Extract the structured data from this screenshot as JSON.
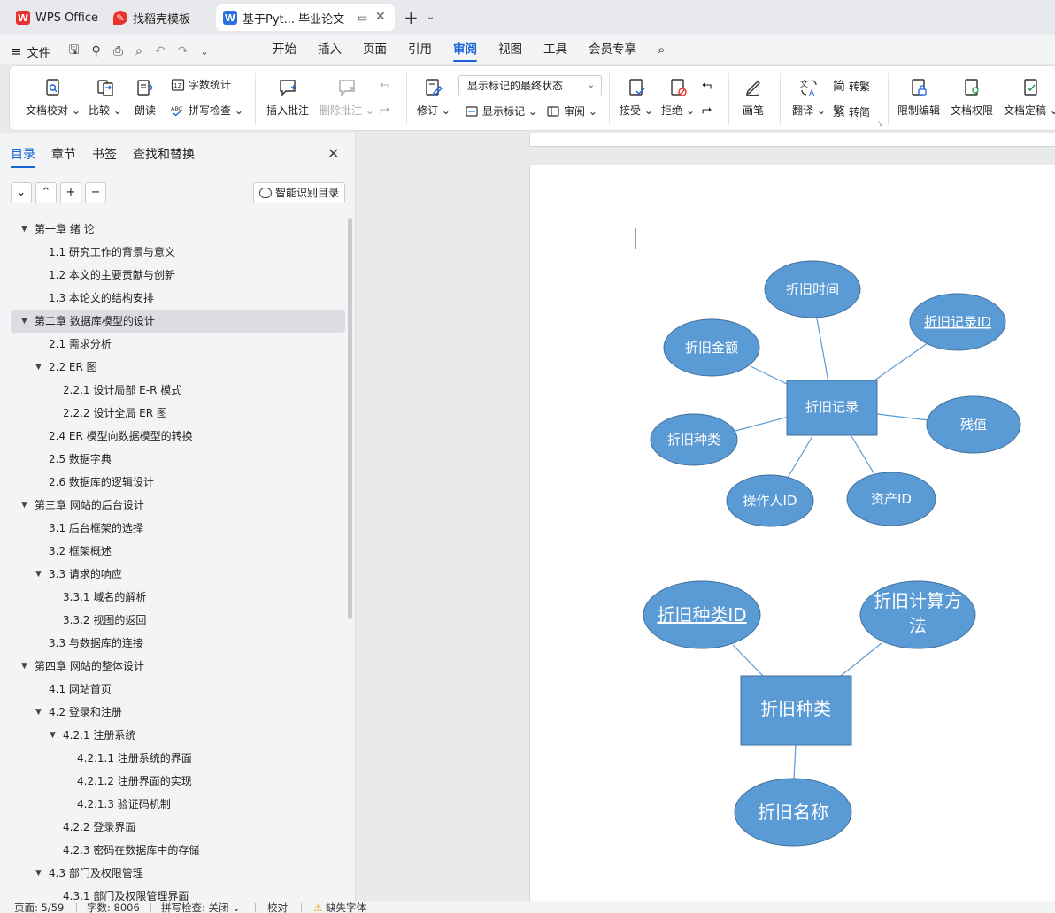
{
  "tabs": [
    {
      "label": "WPS Office",
      "icon": "wps-logo-icon"
    },
    {
      "label": "找稻壳模板",
      "icon": "docer-icon"
    },
    {
      "label": "基于Pyt... 毕业论文",
      "icon": "word-doc-icon"
    }
  ],
  "menu": {
    "file": "文件",
    "tabs": [
      "开始",
      "插入",
      "页面",
      "引用",
      "审阅",
      "视图",
      "工具",
      "会员专享"
    ],
    "active_tab": "审阅"
  },
  "ribbon": {
    "doc_check": "文档校对",
    "compare": "比较",
    "read_aloud": "朗读",
    "word_count": "字数统计",
    "spell_check": "拼写检查",
    "insert_comment": "插入批注",
    "delete_comment": "删除批注",
    "revise": "修订",
    "markup_state": "显示标记的最终状态",
    "show_markup": "显示标记",
    "review": "审阅",
    "accept": "接受",
    "reject": "拒绝",
    "pen": "画笔",
    "translate": "翻译",
    "to_traditional": "转繁",
    "to_simplified": "转简",
    "restrict_edit": "限制编辑",
    "doc_permission": "文档权限",
    "doc_finalize": "文档定稿"
  },
  "nav": {
    "tabs": [
      "目录",
      "章节",
      "书签",
      "查找和替换"
    ],
    "smart_toc": "智能识别目录",
    "toc": [
      {
        "text": "第一章  绪  论",
        "level": 0,
        "expand": true
      },
      {
        "text": "1.1  研究工作的背景与意义",
        "level": 1
      },
      {
        "text": "1.2  本文的主要贡献与创新",
        "level": 1
      },
      {
        "text": "1.3  本论文的结构安排",
        "level": 1
      },
      {
        "text": "第二章  数据库模型的设计",
        "level": 0,
        "expand": true,
        "selected": true
      },
      {
        "text": "2.1  需求分析",
        "level": 1
      },
      {
        "text": "2.2 ER 图",
        "level": 1,
        "expand": true
      },
      {
        "text": "2.2.1  设计局部 E-R 模式",
        "level": 2
      },
      {
        "text": "2.2.2  设计全局 ER 图",
        "level": 2
      },
      {
        "text": "2.4 ER 模型向数据模型的转换",
        "level": 1
      },
      {
        "text": "2.5  数据字典",
        "level": 1
      },
      {
        "text": "2.6  数据库的逻辑设计",
        "level": 1
      },
      {
        "text": "第三章  网站的后台设计",
        "level": 0,
        "expand": true
      },
      {
        "text": "3.1  后台框架的选择",
        "level": 1
      },
      {
        "text": "3.2  框架概述",
        "level": 1
      },
      {
        "text": "3.3  请求的响应",
        "level": 1,
        "expand": true
      },
      {
        "text": "3.3.1  域名的解析",
        "level": 2
      },
      {
        "text": "3.3.2  视图的返回",
        "level": 2
      },
      {
        "text": "3.3  与数据库的连接",
        "level": 1
      },
      {
        "text": "第四章  网站的整体设计",
        "level": 0,
        "expand": true
      },
      {
        "text": "4.1  网站首页",
        "level": 1
      },
      {
        "text": "4.2  登录和注册",
        "level": 1,
        "expand": true
      },
      {
        "text": "4.2.1  注册系统",
        "level": 2,
        "expand": true
      },
      {
        "text": "4.2.1.1 注册系统的界面",
        "level": 3
      },
      {
        "text": "4.2.1.2  注册界面的实现",
        "level": 3
      },
      {
        "text": "4.2.1.3  验证码机制",
        "level": 3
      },
      {
        "text": "4.2.2  登录界面",
        "level": 2
      },
      {
        "text": "4.2.3  密码在数据库中的存储",
        "level": 2
      },
      {
        "text": "4.3  部门及权限管理",
        "level": 1,
        "expand": true
      },
      {
        "text": "4.3.1  部门及权限管理界面",
        "level": 2
      }
    ]
  },
  "diagram": {
    "er1": {
      "entity": "折旧记录",
      "attributes": [
        "折旧时间",
        "折旧记录ID",
        "折旧金额",
        "残值",
        "折旧种类",
        "操作人ID",
        "资产ID"
      ]
    },
    "er2": {
      "entity": "折旧种类",
      "attributes": [
        "折旧种类ID",
        "折旧计算方",
        "法",
        "折旧名称"
      ]
    },
    "colors": {
      "shape_fill": "#5b9bd5",
      "shape_stroke": "#41719c",
      "text": "#ffffff"
    }
  },
  "status": {
    "page": "页面: 5/59",
    "words": "字数: 8006",
    "spell": "拼写检查: 关闭",
    "proof": "校对",
    "missing_font": "缺失字体"
  }
}
